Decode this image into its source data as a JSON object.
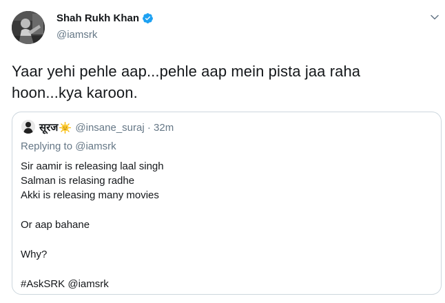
{
  "tweet": {
    "author_name": "Shah Rukh Khan",
    "author_handle": "@iamsrk",
    "text_line1": "Yaar yehi pehle aap...pehle aap mein pista jaa raha",
    "text_line2": "hoon...kya karoon."
  },
  "quote": {
    "author_name": "सूरज",
    "handle": "@insane_suraj",
    "separator": " · ",
    "time": "32m",
    "replying_to": "Replying to @iamsrk",
    "lines": [
      "Sir aamir is releasing laal singh",
      "Salman is relasing radhe",
      "Akki is releasing many movies",
      "",
      "Or aap bahane",
      "",
      "Why?",
      "",
      "#AskSRK @iamsrk"
    ]
  },
  "icons": {
    "verified": "verified-badge-icon",
    "caret": "chevron-down-icon",
    "emoji": "sun-with-face-emoji"
  },
  "colors": {
    "text": "#14171a",
    "secondary": "#657786",
    "verified": "#1da1f2",
    "border": "#ccd6dd"
  }
}
